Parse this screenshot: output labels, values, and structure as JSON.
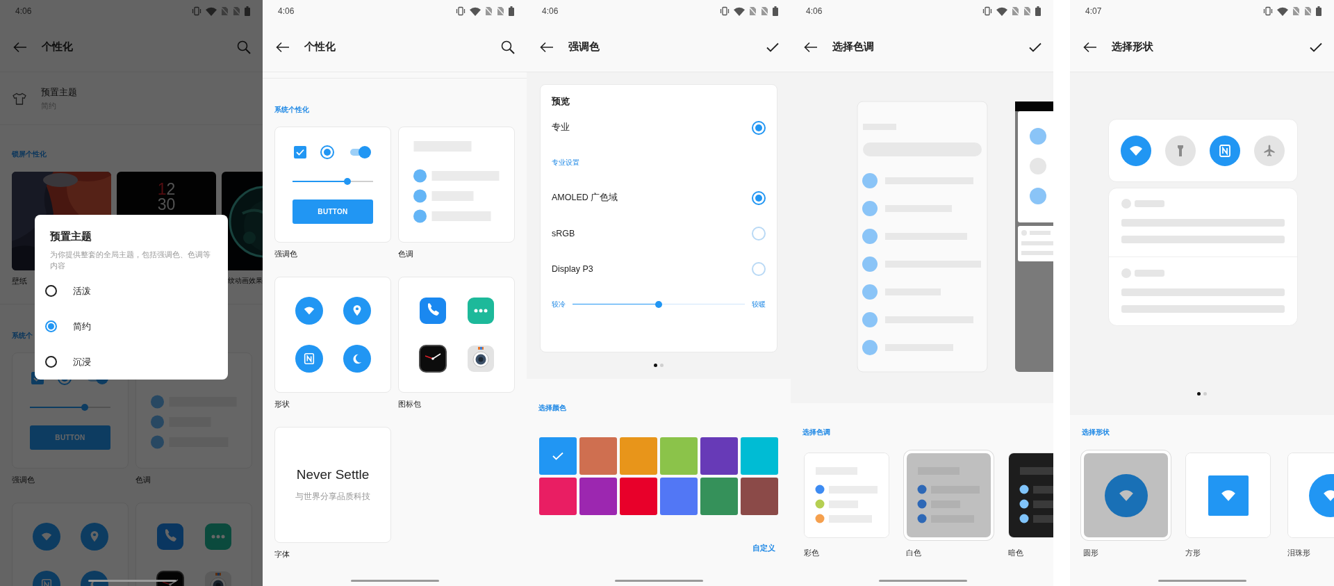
{
  "screens": [
    {
      "kind": "personalize",
      "time": "4:06",
      "title": "个性化",
      "action": {
        "kind": "search"
      },
      "theme_row": {
        "title": "预置主题",
        "value": "简约"
      },
      "sections": [
        {
          "kind": "thumbnails",
          "heading": "锁屏个性化",
          "items": [
            {
              "kind": "painting",
              "label": "壁纸"
            },
            {
              "kind": "clock",
              "hour_first": "1",
              "hour_second": "2",
              "minute": "30"
            },
            {
              "kind": "globe",
              "label": "纹动画效果"
            }
          ]
        },
        {
          "kind": "cards",
          "heading": "系统个",
          "items": [
            {
              "kind": "accent",
              "label": "强调色",
              "checkbox": {
                "checked": true
              },
              "radio": {
                "selected": true
              },
              "toggle": {
                "on": true
              },
              "slider": {
                "level": 0.68
              },
              "button": "BUTTON"
            },
            {
              "kind": "tone",
              "label": "色调"
            },
            {
              "kind": "shape"
            },
            {
              "kind": "iconpack"
            }
          ]
        }
      ],
      "dialog": {
        "title": "预置主题",
        "text": "为你提供整套的全局主题，包括强调色、色调等内容",
        "options": [
          {
            "label": "活泼",
            "selected": false
          },
          {
            "label": "简约",
            "selected": true
          },
          {
            "label": "沉浸",
            "selected": false
          }
        ]
      }
    },
    {
      "kind": "personalize",
      "time": "4:06",
      "title": "个性化",
      "action": {
        "kind": "search"
      },
      "sections": [
        {
          "kind": "cards",
          "heading": "系统个性化",
          "items": [
            {
              "kind": "accent",
              "label": "强调色",
              "checkbox": {
                "checked": true
              },
              "radio": {
                "selected": true
              },
              "toggle": {
                "on": true
              },
              "slider": {
                "level": 0.68
              },
              "button": "BUTTON"
            },
            {
              "kind": "tone",
              "label": "色调"
            },
            {
              "kind": "shape",
              "label": "形状"
            },
            {
              "kind": "iconpack",
              "label": "图标包"
            },
            {
              "kind": "font",
              "label": "字体",
              "sample": "Never Settle",
              "subtitle": "与世界分享品质科技"
            }
          ]
        }
      ]
    },
    {
      "kind": "accent",
      "time": "4:06",
      "title": "强调色",
      "action": {
        "kind": "check"
      },
      "preview": {
        "title": "预览",
        "rows": [
          {
            "kind": "radio",
            "label": "专业",
            "selected": true
          },
          {
            "kind": "subheading",
            "label": "专业设置"
          },
          {
            "kind": "radio",
            "label": "AMOLED 广色域",
            "selected": true
          },
          {
            "kind": "radio",
            "label": "sRGB",
            "selected": false
          },
          {
            "kind": "radio",
            "label": "Display P3",
            "selected": false
          },
          {
            "kind": "slider",
            "min_label": "较冷",
            "max_label": "较暖",
            "level": 0.5
          }
        ]
      },
      "dots": [
        {
          "selected": true
        },
        {
          "selected": false
        }
      ],
      "heading": "选择颜色",
      "swatches": [
        {
          "color": "#2196f3",
          "selected": true
        },
        {
          "color": "#cf6f50",
          "selected": false
        },
        {
          "color": "#e8951a",
          "selected": false
        },
        {
          "color": "#8bc34a",
          "selected": false
        },
        {
          "color": "#673ab7",
          "selected": false
        },
        {
          "color": "#00bcd4",
          "selected": false
        },
        {
          "color": "#e91e63",
          "selected": false
        },
        {
          "color": "#9c27b0",
          "selected": false
        },
        {
          "color": "#e8002a",
          "selected": false
        },
        {
          "color": "#5277f5",
          "selected": false
        },
        {
          "color": "#35915a",
          "selected": false
        },
        {
          "color": "#8b4a48",
          "selected": false
        }
      ],
      "link": "自定义"
    },
    {
      "kind": "tone",
      "time": "4:06",
      "title": "选择色调",
      "action": {
        "kind": "check"
      },
      "heading": "选择色调",
      "options": [
        {
          "kind": "colorful",
          "label": "彩色",
          "selected": false
        },
        {
          "kind": "light",
          "label": "白色",
          "selected": true
        },
        {
          "kind": "dark",
          "label": "暗色",
          "selected": false
        }
      ]
    },
    {
      "kind": "shape",
      "time": "4:07",
      "title": "选择形状",
      "action": {
        "kind": "check"
      },
      "tiles": [
        {
          "on": true
        },
        {
          "on": false
        },
        {
          "on": true
        },
        {
          "on": false
        }
      ],
      "dots": [
        {
          "selected": true
        },
        {
          "selected": false
        }
      ],
      "heading": "选择形状",
      "options": [
        {
          "kind": "circle",
          "label": "圆形",
          "selected": true
        },
        {
          "kind": "square",
          "label": "方形",
          "selected": false
        },
        {
          "kind": "teardrop",
          "label": "泪珠形",
          "selected": false
        }
      ]
    }
  ]
}
